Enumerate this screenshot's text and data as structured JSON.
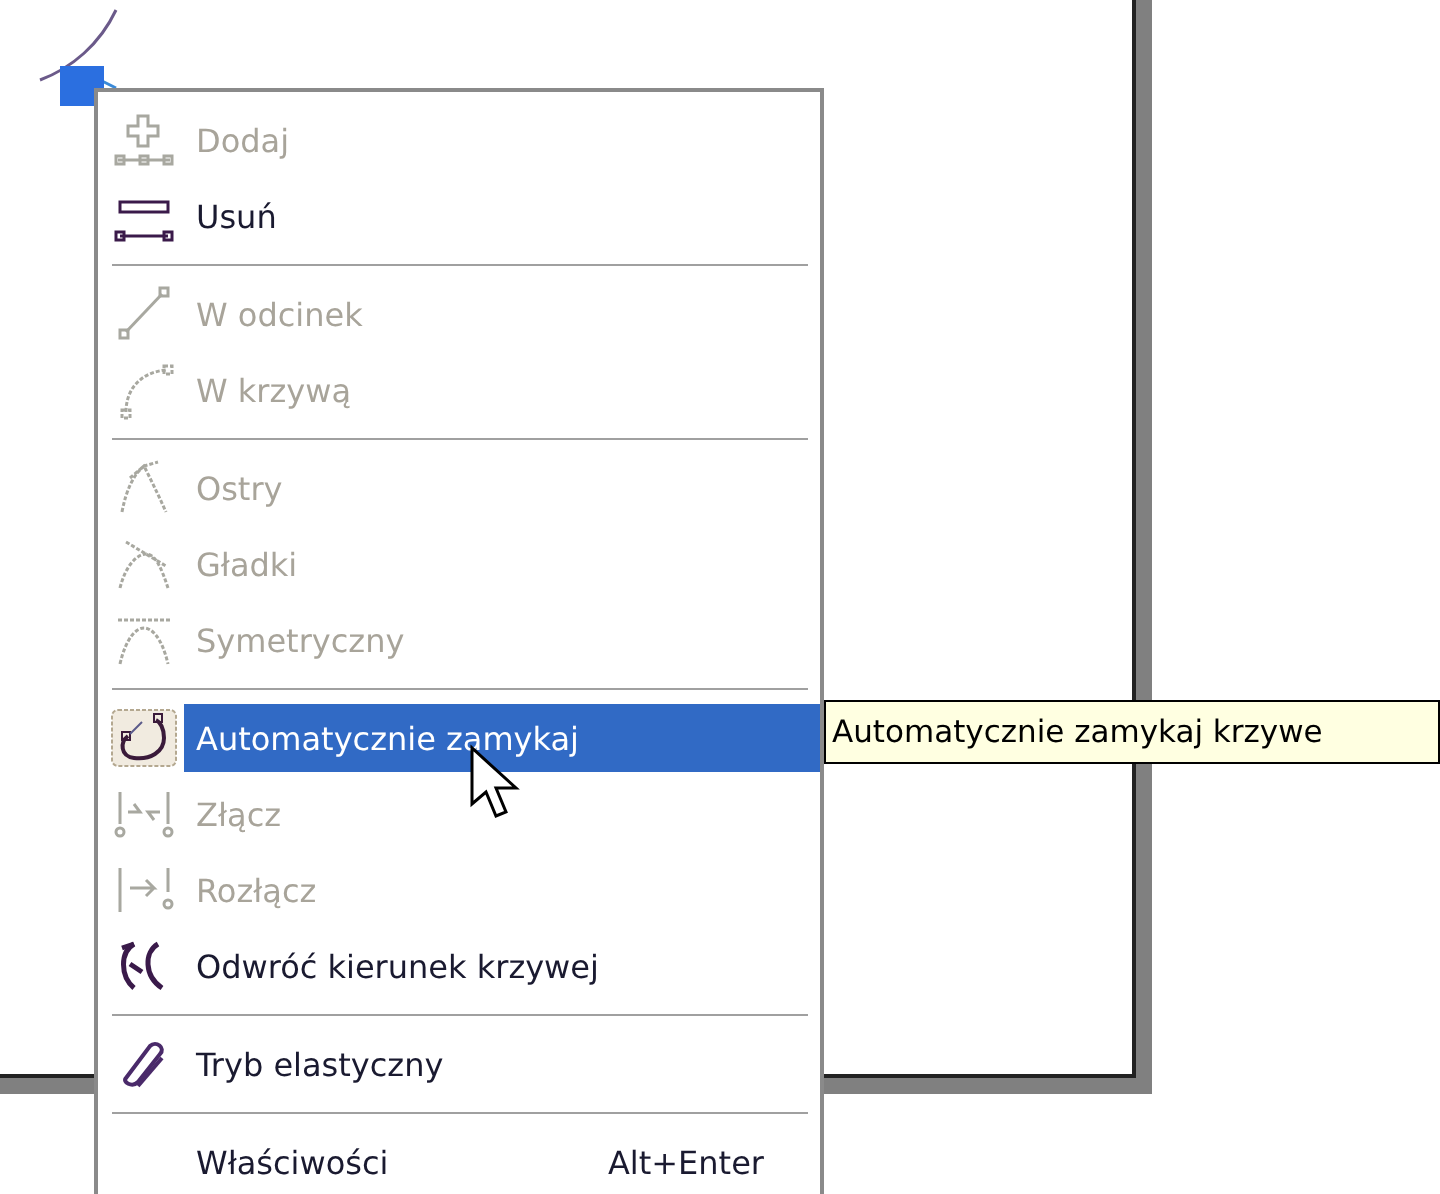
{
  "context_menu": {
    "items": [
      {
        "kind": "item",
        "label": "Dodaj",
        "disabled": true,
        "selected": false
      },
      {
        "kind": "item",
        "label": "Usuń",
        "disabled": false,
        "selected": false
      },
      {
        "kind": "separator"
      },
      {
        "kind": "item",
        "label": "W odcinek",
        "disabled": true,
        "selected": false
      },
      {
        "kind": "item",
        "label": "W krzywą",
        "disabled": true,
        "selected": false
      },
      {
        "kind": "separator"
      },
      {
        "kind": "item",
        "label": "Ostry",
        "disabled": true,
        "selected": false
      },
      {
        "kind": "item",
        "label": "Gładki",
        "disabled": true,
        "selected": false
      },
      {
        "kind": "item",
        "label": "Symetryczny",
        "disabled": true,
        "selected": false
      },
      {
        "kind": "separator"
      },
      {
        "kind": "item",
        "label": "Automatycznie zamykaj",
        "disabled": false,
        "selected": true
      },
      {
        "kind": "item",
        "label": "Złącz",
        "disabled": true,
        "selected": false
      },
      {
        "kind": "item",
        "label": "Rozłącz",
        "disabled": true,
        "selected": false
      },
      {
        "kind": "item",
        "label": "Odwróć kierunek krzywej",
        "disabled": false,
        "selected": false
      },
      {
        "kind": "separator"
      },
      {
        "kind": "item",
        "label": "Tryb elastyczny",
        "disabled": false,
        "selected": false
      },
      {
        "kind": "separator"
      },
      {
        "kind": "item",
        "label": "Właściwości",
        "shortcut": "Alt+Enter",
        "disabled": false,
        "selected": false
      }
    ]
  },
  "tooltip": {
    "text": "Automatycznie zamykaj krzywe"
  }
}
